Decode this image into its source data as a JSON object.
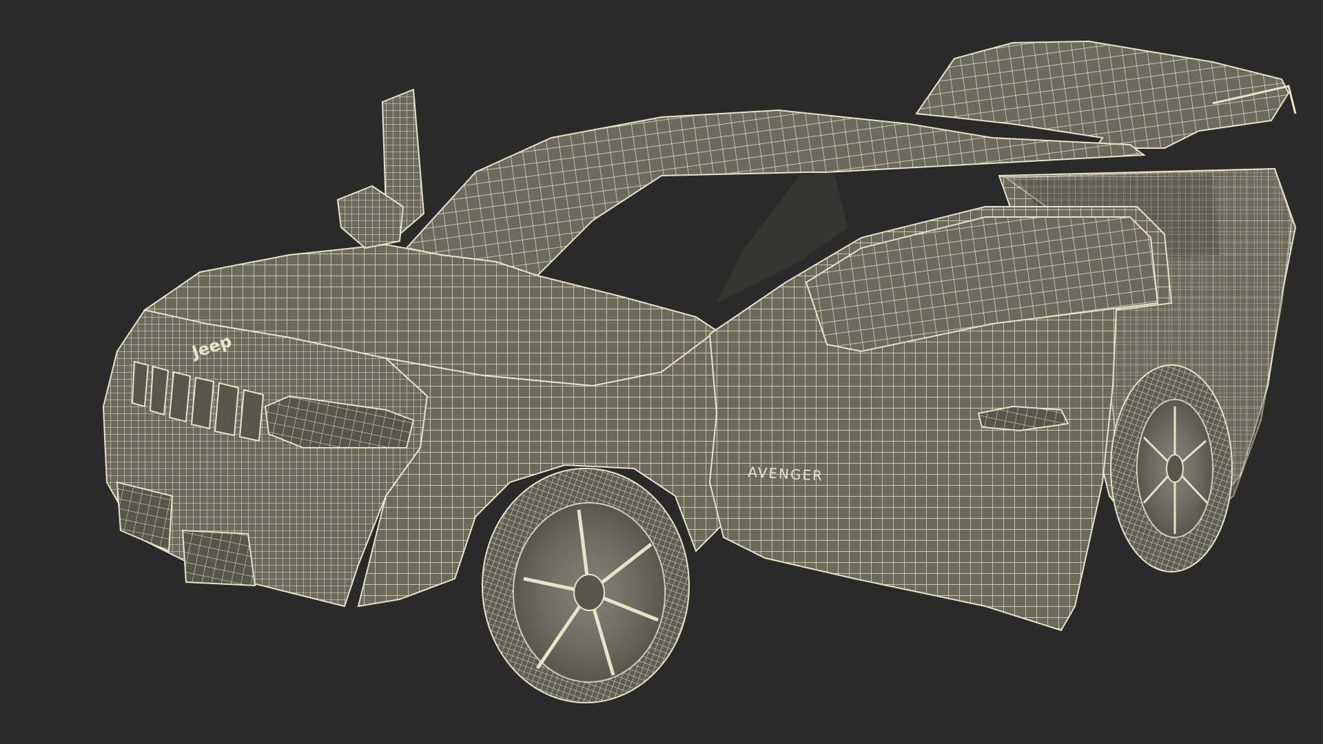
{
  "scene": {
    "subject": "wireframe-suv",
    "colors": {
      "background": "#2a2a2a",
      "surface": "#6b6a5c",
      "surface_dark": "#56564a",
      "surface_light": "#7b7a6a",
      "wire": "#e7e5c8",
      "cavity": "#3a3a34",
      "tire": "#5e5d52"
    }
  },
  "badges": {
    "grille_logo": "Jeep",
    "door_model": "AVENGER"
  }
}
